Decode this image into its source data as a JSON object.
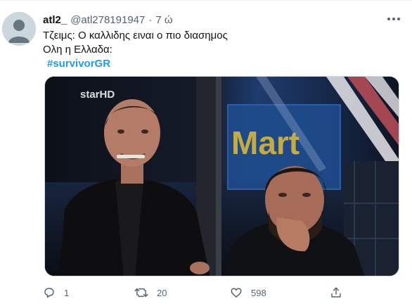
{
  "tweet": {
    "display_name": "atl2_",
    "handle": "@atl278191947",
    "separator": "·",
    "time": "7 ώ",
    "lines": [
      "Τζειμς: Ο καλλιδης ειναι ο πιο διασημος",
      "Ολη η Ελλαδα:"
    ],
    "hashtag": "#survivorGR",
    "media": {
      "watermark": "starHD",
      "sign_text": "Mart"
    },
    "actions": {
      "reply_count": "1",
      "retweet_count": "20",
      "like_count": "598"
    }
  },
  "colors": {
    "accent": "#1d9bf0",
    "secondary_text": "#536471",
    "primary_text": "#0f1419"
  },
  "icons": [
    "avatar-default-icon",
    "more-icon",
    "reply-icon",
    "retweet-icon",
    "like-icon",
    "share-icon"
  ]
}
